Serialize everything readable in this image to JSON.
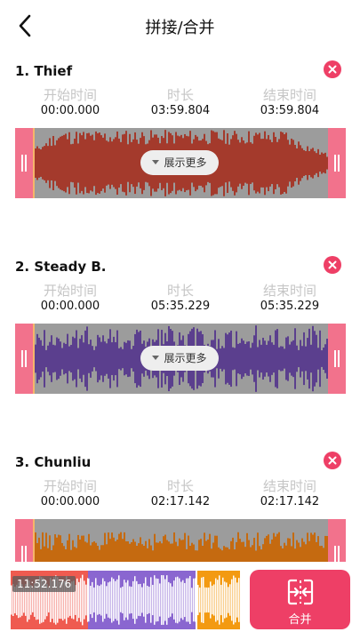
{
  "header": {
    "title": "拼接/合并",
    "back_icon": "chevron-left-icon"
  },
  "labels": {
    "start": "开始时间",
    "duration": "时长",
    "end": "结束时间",
    "show_more": "展示更多"
  },
  "tracks": [
    {
      "name": "1. Thief",
      "start": "00:00.000",
      "duration": "03:59.804",
      "end": "03:59.804",
      "wave_color": "#a43a2c"
    },
    {
      "name": "2. Steady B.",
      "start": "00:00.000",
      "duration": "05:35.229",
      "end": "05:35.229",
      "wave_color": "#5b3f8e"
    },
    {
      "name": "3. Chunliu",
      "start": "00:00.000",
      "duration": "02:17.142",
      "end": "02:17.142",
      "wave_color": "#c56a10"
    }
  ],
  "bottom": {
    "total_duration": "11:52.176",
    "merge_label": "合并",
    "segment_colors": [
      "#ef5b50",
      "#8a66d0",
      "#f39a12"
    ]
  },
  "colors": {
    "accent": "#ee3f66",
    "handle": "#f2728c",
    "wave_bg": "#9c9c9c"
  }
}
